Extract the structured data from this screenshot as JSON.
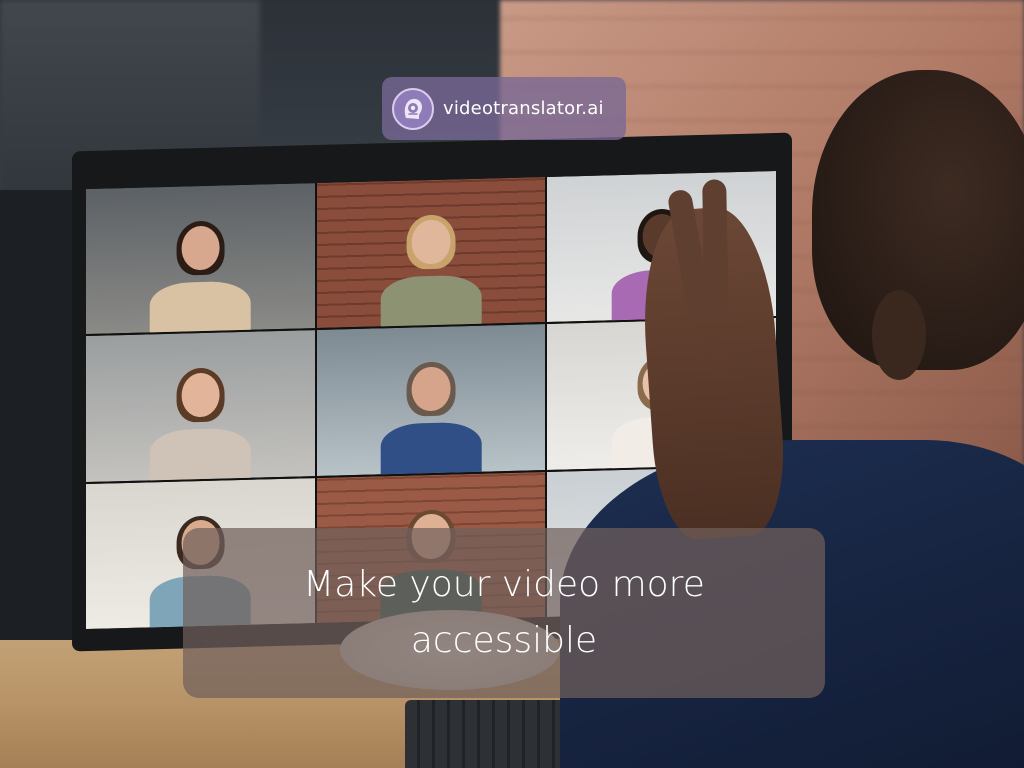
{
  "brand": {
    "name": "videotranslator.ai",
    "logo_icon": "robot-face-icon",
    "badge_color": "#7868a0"
  },
  "caption": {
    "text": "Make your video more accessible"
  },
  "scene": {
    "description_icon": "video-call-grid",
    "participant_count": 9
  }
}
